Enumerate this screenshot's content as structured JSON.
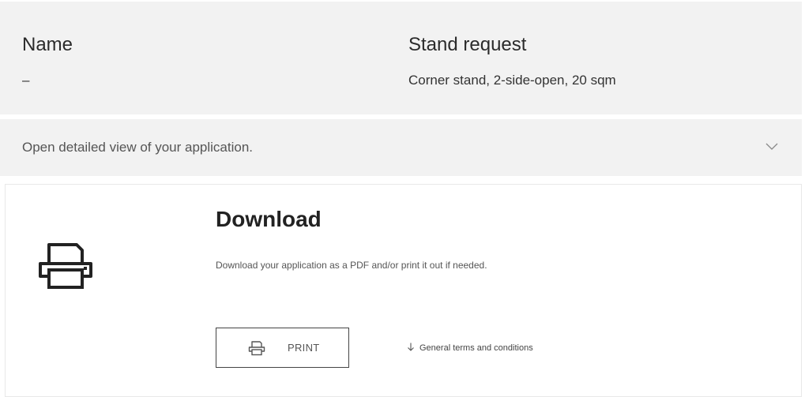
{
  "summary": {
    "name_label": "Name",
    "name_value": "–",
    "stand_label": "Stand request",
    "stand_value": "Corner stand, 2-side-open, 20 sqm"
  },
  "details": {
    "toggle_text": "Open detailed view of your application.",
    "toggle_icon": "chevron-down-icon"
  },
  "download": {
    "icon": "printer-icon",
    "title": "Download",
    "description": "Download your application as a PDF and/or print it out if needed.",
    "print_button_icon": "printer-icon",
    "print_button_label": "PRINT",
    "terms_icon": "arrow-down-icon",
    "terms_link": "General terms and conditions"
  },
  "colors": {
    "panel_background": "#f2f2f2",
    "text_primary": "#2b2b2b",
    "text_secondary": "#555555",
    "card_border": "#e8e8e8",
    "button_border": "#444444"
  }
}
